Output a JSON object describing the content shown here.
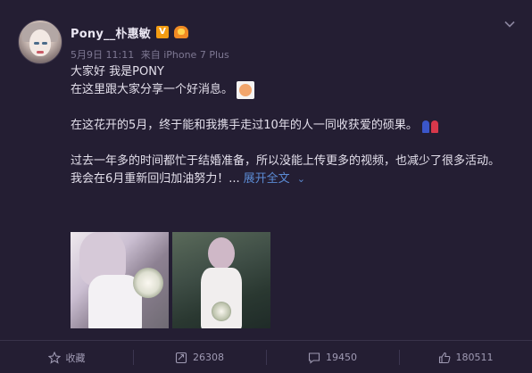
{
  "post": {
    "username": "Pony__朴惠敏",
    "verified_label": "V",
    "meta": {
      "date": "5月9日 11:11",
      "source": "来自 iPhone 7 Plus"
    },
    "lines": {
      "l1": "大家好 我是PONY",
      "l2": "在这里跟大家分享一个好消息。",
      "l3": "在这花开的5月，终于能和我携手走过10年的人一同收获爱的硕果。",
      "l4": "过去一年多的时间都忙于结婚准备，所以没能上传更多的视频，也减少了很多活动。",
      "l5": "我会在6月重新回归加油努力！..."
    },
    "expand_label": "展开全文",
    "icons": {
      "avatar": "avatar",
      "verified": "verified-badge-icon",
      "vip": "vip-badge-icon",
      "menu": "chevron-down-icon",
      "emoji1": "smiley-sticker-icon",
      "emoji2": "couple-emoji-icon"
    }
  },
  "actions": {
    "collect": {
      "label": "收藏",
      "icon": "star-icon"
    },
    "repost": {
      "label": "26308",
      "icon": "repost-icon"
    },
    "comment": {
      "label": "19450",
      "icon": "comment-icon"
    },
    "like": {
      "label": "180511",
      "icon": "thumbs-up-icon"
    }
  },
  "colors": {
    "background": "#241e33",
    "link": "#5b8bd4",
    "verified": "#f39c12"
  }
}
